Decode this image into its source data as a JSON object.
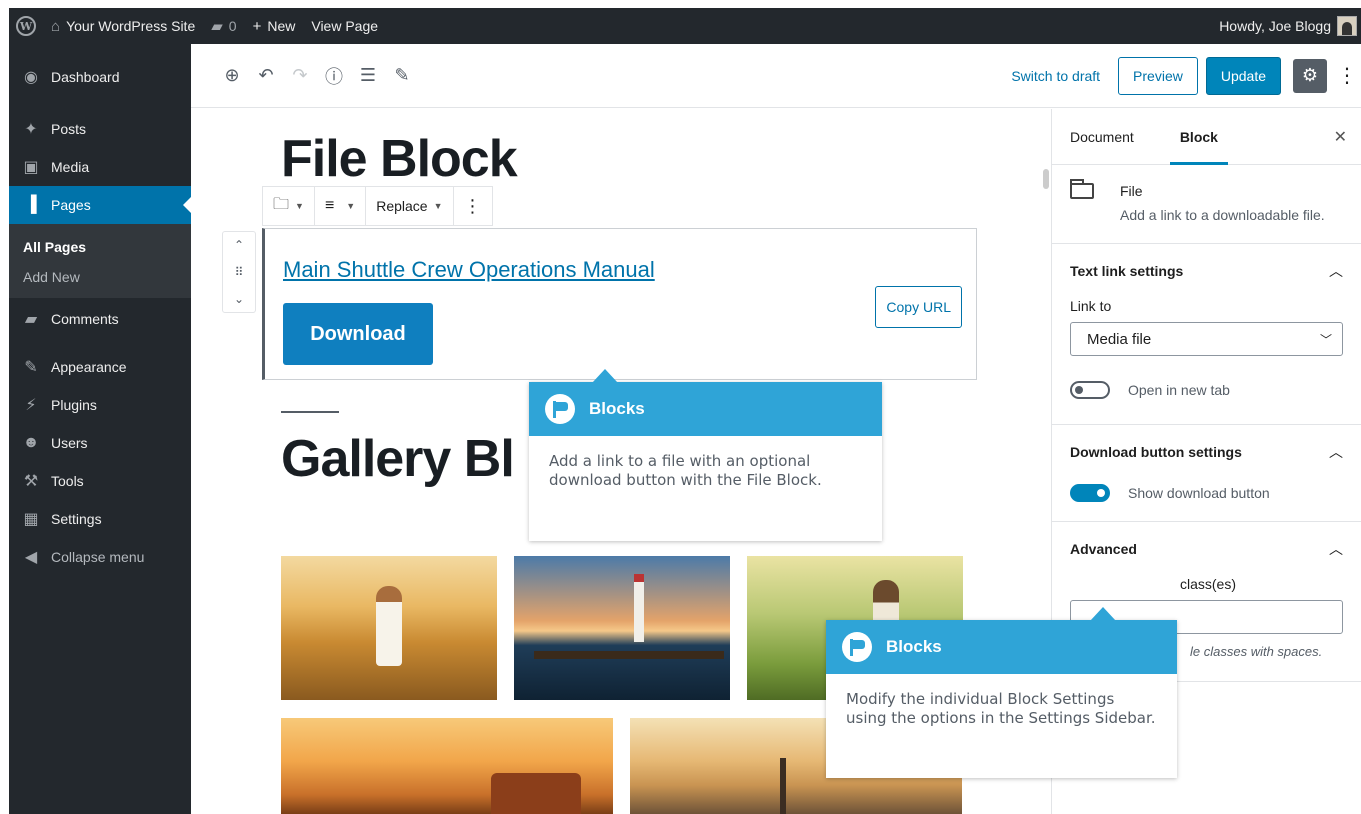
{
  "adminbar": {
    "site_name": "Your WordPress Site",
    "comments_count": "0",
    "new_label": "New",
    "view_page": "View Page",
    "howdy": "Howdy, Joe Blogg"
  },
  "menu": {
    "dashboard": "Dashboard",
    "posts": "Posts",
    "media": "Media",
    "pages": "Pages",
    "all_pages": "All Pages",
    "add_new": "Add New",
    "comments": "Comments",
    "appearance": "Appearance",
    "plugins": "Plugins",
    "users": "Users",
    "tools": "Tools",
    "settings": "Settings",
    "collapse": "Collapse menu"
  },
  "header": {
    "switch_to_draft": "Switch to draft",
    "preview": "Preview",
    "update": "Update"
  },
  "content": {
    "title": "File Block",
    "replace": "Replace",
    "file_name": "Main Shuttle Crew Operations Manual",
    "download": "Download",
    "copy_url": "Copy URL",
    "gallery_heading": "Gallery Bl"
  },
  "sidebar": {
    "tab_document": "Document",
    "tab_block": "Block",
    "block_name": "File",
    "block_desc": "Add a link to a downloadable file.",
    "text_link_settings": "Text link settings",
    "link_to": "Link to",
    "link_to_value": "Media file",
    "open_new_tab": "Open in new tab",
    "download_button_settings": "Download button settings",
    "show_download_button": "Show download button",
    "advanced": "Advanced",
    "css_classes_partial": "class(es)",
    "css_help_partial": "le classes with spaces."
  },
  "tooltips": [
    {
      "title": "Blocks",
      "body": "Add a link to a file with an optional download button with the File Block."
    },
    {
      "title": "Blocks",
      "body": "Modify the individual Block Settings using the options in the Settings Sidebar."
    }
  ],
  "colors": {
    "admin_dark": "#23282d",
    "accent_blue": "#0085ba",
    "tooltip_blue": "#2fa4d7"
  }
}
